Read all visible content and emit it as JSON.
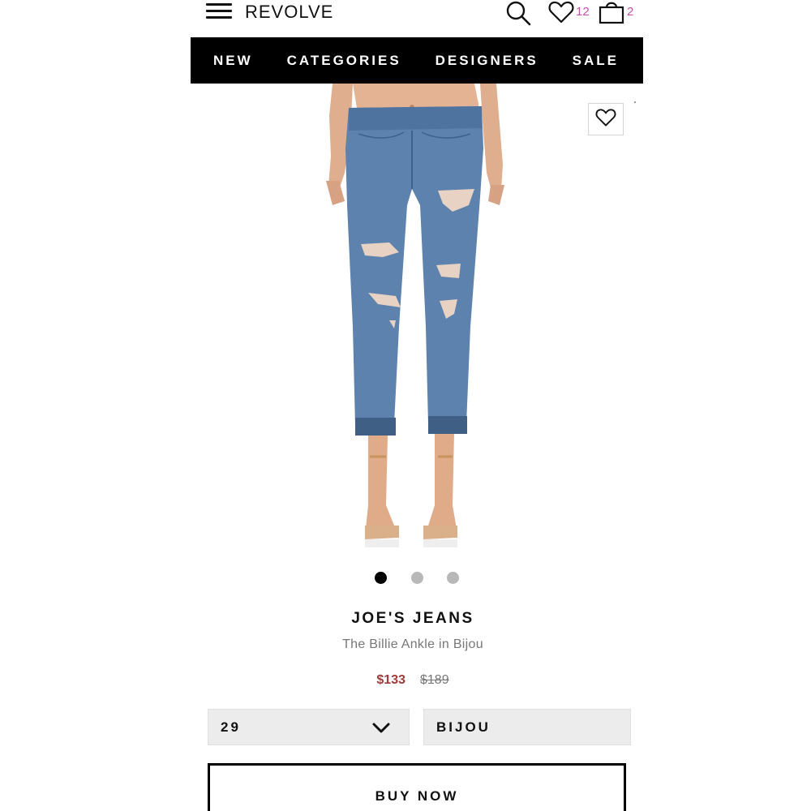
{
  "header": {
    "logo": "REVOLVE",
    "icons": [
      "menu-icon",
      "search-icon",
      "heart-icon",
      "bag-icon"
    ],
    "wishlist_count": "12",
    "bag_count": "2",
    "badge_color": "#c94fb0"
  },
  "nav": {
    "items": [
      "NEW",
      "CATEGORIES",
      "DESIGNERS",
      "SALE"
    ]
  },
  "gallery": {
    "total_images": 3,
    "active_index": 0
  },
  "product": {
    "brand": "JOE'S JEANS",
    "name": "The Billie Ankle in Bijou",
    "sale_price": "$133",
    "original_price": "$189",
    "sale_color": "#a23b3b"
  },
  "options": {
    "size_value": "29",
    "color_value": "BIJOU"
  },
  "actions": {
    "buy_label": "BUY NOW"
  }
}
